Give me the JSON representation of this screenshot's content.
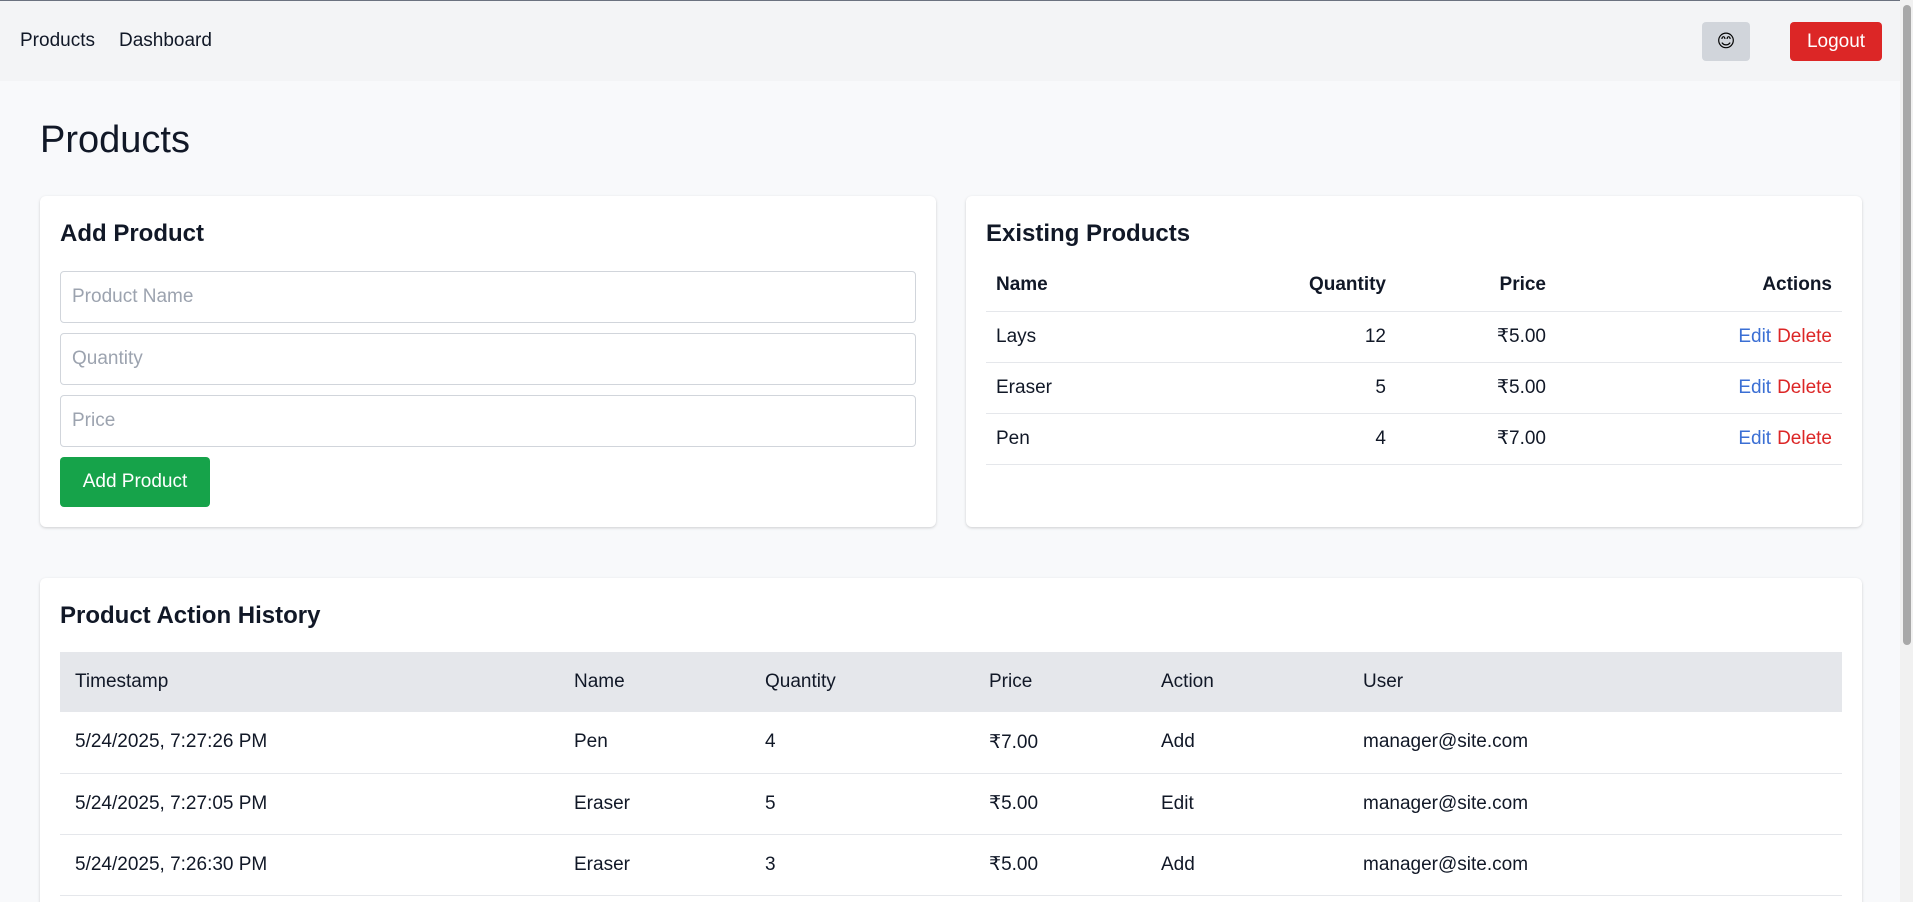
{
  "nav": {
    "products": "Products",
    "dashboard": "Dashboard",
    "theme_emoji": "😊",
    "logout": "Logout"
  },
  "page": {
    "title": "Products"
  },
  "add_product": {
    "title": "Add Product",
    "name_placeholder": "Product Name",
    "quantity_placeholder": "Quantity",
    "price_placeholder": "Price",
    "submit_label": "Add Product"
  },
  "existing": {
    "title": "Existing Products",
    "headers": {
      "name": "Name",
      "quantity": "Quantity",
      "price": "Price",
      "actions": "Actions"
    },
    "edit_label": "Edit",
    "delete_label": "Delete",
    "rows": [
      {
        "name": "Lays",
        "quantity": "12",
        "price": "₹5.00"
      },
      {
        "name": "Eraser",
        "quantity": "5",
        "price": "₹5.00"
      },
      {
        "name": "Pen",
        "quantity": "4",
        "price": "₹7.00"
      }
    ]
  },
  "history": {
    "title": "Product Action History",
    "headers": {
      "timestamp": "Timestamp",
      "name": "Name",
      "quantity": "Quantity",
      "price": "Price",
      "action": "Action",
      "user": "User"
    },
    "rows": [
      {
        "timestamp": "5/24/2025, 7:27:26 PM",
        "name": "Pen",
        "quantity": "4",
        "price": "₹7.00",
        "action": "Add",
        "user": "manager@site.com"
      },
      {
        "timestamp": "5/24/2025, 7:27:05 PM",
        "name": "Eraser",
        "quantity": "5",
        "price": "₹5.00",
        "action": "Edit",
        "user": "manager@site.com"
      },
      {
        "timestamp": "5/24/2025, 7:26:30 PM",
        "name": "Eraser",
        "quantity": "3",
        "price": "₹5.00",
        "action": "Add",
        "user": "manager@site.com"
      }
    ]
  },
  "colors": {
    "add_button": "#16a34a",
    "logout_button": "#dc2626",
    "edit_link": "#3b6fd4",
    "delete_link": "#dc2626"
  }
}
